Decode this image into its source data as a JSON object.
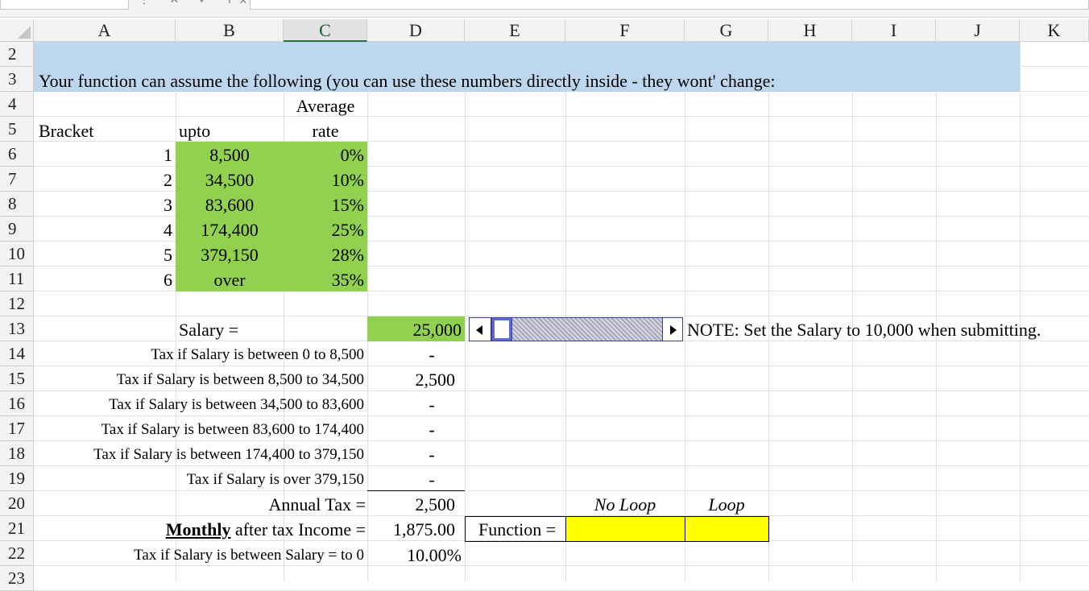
{
  "toolbar": {
    "formula_icons": "⋮ ✕ ✓ fx"
  },
  "columns": [
    "A",
    "B",
    "C",
    "D",
    "E",
    "F",
    "G",
    "H",
    "I",
    "J",
    "K"
  ],
  "rows": [
    "2",
    "3",
    "4",
    "5",
    "6",
    "7",
    "8",
    "9",
    "10",
    "11",
    "12",
    "13",
    "14",
    "15",
    "16",
    "17",
    "18",
    "19",
    "20",
    "21",
    "22",
    "23"
  ],
  "selected_column": "C",
  "heading": "Your function can assume the following (you can use these numbers directly inside - they wont' change:",
  "bracket_table": {
    "bracket_header": "Bracket",
    "upto_header": "upto",
    "rate_header_line1": "Average",
    "rate_header_line2": "rate",
    "rows": [
      {
        "bracket": "1",
        "upto": "8,500",
        "rate": "0%"
      },
      {
        "bracket": "2",
        "upto": "34,500",
        "rate": "10%"
      },
      {
        "bracket": "3",
        "upto": "83,600",
        "rate": "15%"
      },
      {
        "bracket": "4",
        "upto": "174,400",
        "rate": "25%"
      },
      {
        "bracket": "5",
        "upto": "379,150",
        "rate": "28%"
      },
      {
        "bracket": "6",
        "upto": "over",
        "rate": "35%"
      }
    ]
  },
  "salary": {
    "label": "Salary =",
    "value": "25,000",
    "note": "NOTE: Set the Salary to 10,000 when submitting."
  },
  "tax_lines": [
    {
      "label": "Tax if Salary is between 0 to 8,500",
      "value": "-"
    },
    {
      "label": "Tax if Salary is between 8,500 to 34,500",
      "value": "2,500"
    },
    {
      "label": "Tax if Salary is between 34,500 to 83,600",
      "value": "-"
    },
    {
      "label": "Tax if Salary is between 83,600 to 174,400",
      "value": "-"
    },
    {
      "label": "Tax if Salary is between 174,400 to 379,150",
      "value": "-"
    },
    {
      "label": "Tax if Salary is over 379,150",
      "value": "-"
    }
  ],
  "annual_tax": {
    "label": "Annual Tax =",
    "value": "2,500"
  },
  "monthly": {
    "label_bold": "Monthly",
    "label_rest": " after tax Income =",
    "value": "1,875.00"
  },
  "row22": {
    "label": "Tax if Salary is between Salary = to 0",
    "value": "10.00%"
  },
  "function_row": {
    "label": "Function =",
    "no_loop_header": "No Loop",
    "loop_header": "Loop"
  },
  "colors": {
    "blue_fill": "#bdd7ee",
    "green_fill": "#92d050",
    "yellow_fill": "#ffff00"
  }
}
